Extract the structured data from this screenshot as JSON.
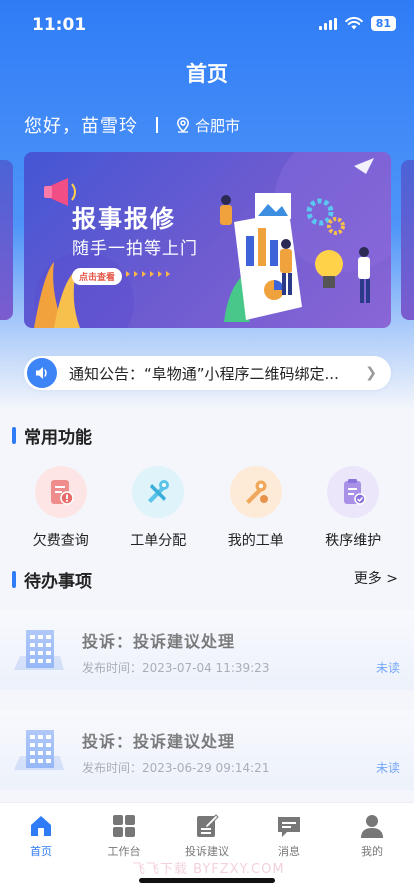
{
  "status_bar": {
    "time": "11:01",
    "battery": "81"
  },
  "header": {
    "title": "首页",
    "greeting": "您好，苗雪玲",
    "city": "合肥市"
  },
  "banner": {
    "title": "报事报修",
    "subtitle": "随手一拍等上门",
    "button_label": "点击查看"
  },
  "notice": {
    "text": "通知公告：“阜物通”小程序二维码绑定..."
  },
  "functions": {
    "title": "常用功能",
    "items": [
      {
        "label": "欠费查询",
        "icon": "bill-query-icon",
        "color": "#ef8d8d"
      },
      {
        "label": "工单分配",
        "icon": "tools-icon",
        "color": "#5bc4e8"
      },
      {
        "label": "我的工单",
        "icon": "wrench-icon",
        "color": "#f0a95c"
      },
      {
        "label": "秩序维护",
        "icon": "checklist-icon",
        "color": "#a991e8"
      }
    ]
  },
  "todo": {
    "title": "待办事项",
    "more_label": "更多 >",
    "items": [
      {
        "title": "投诉：投诉建议处理",
        "time": "发布时间：2023-07-04 11:39:23",
        "status": "未读"
      },
      {
        "title": "投诉：投诉建议处理",
        "time": "发布时间：2023-06-29 09:14:21",
        "status": "未读"
      }
    ]
  },
  "tabbar": {
    "active": "首页",
    "tabs": [
      {
        "label": "首页",
        "icon": "home-icon"
      },
      {
        "label": "工作台",
        "icon": "grid-icon"
      },
      {
        "label": "投诉建议",
        "icon": "edit-document-icon"
      },
      {
        "label": "消息",
        "icon": "message-icon"
      },
      {
        "label": "我的",
        "icon": "user-icon"
      }
    ]
  },
  "watermark": "飞飞下载 BYFZXY.COM",
  "colors": {
    "primary": "#2f7cf6",
    "unread": "#3d84f6"
  }
}
